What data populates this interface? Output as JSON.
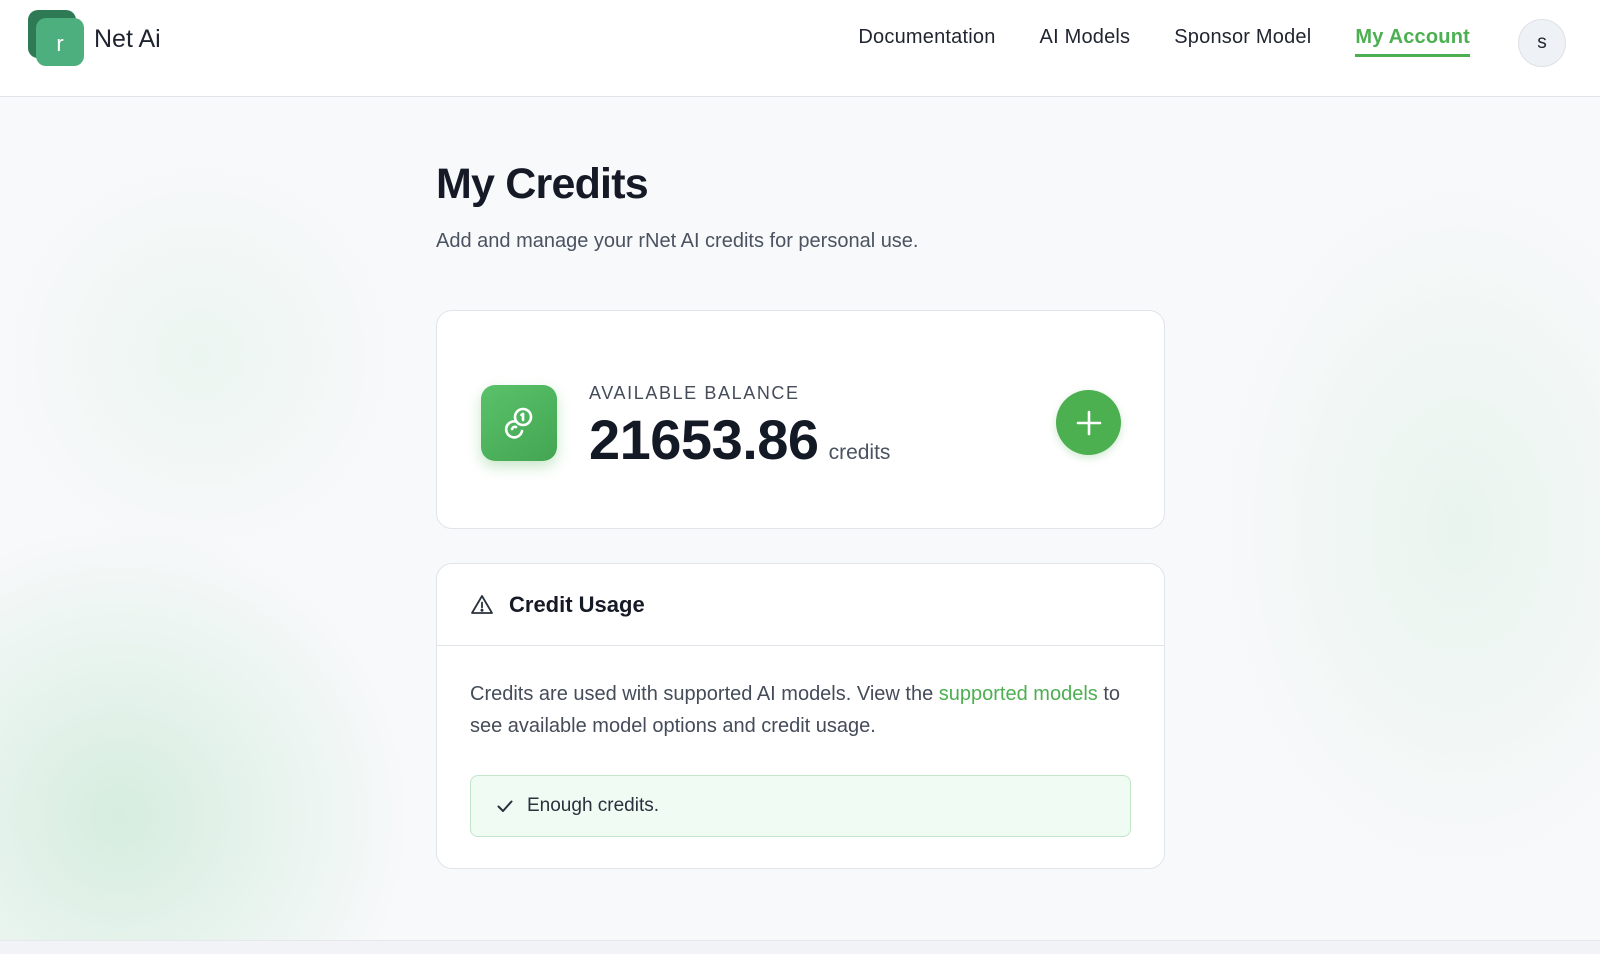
{
  "brand": {
    "logo_letter": "r",
    "name": "Net Ai"
  },
  "nav": {
    "items": [
      {
        "label": "Documentation"
      },
      {
        "label": "AI Models"
      },
      {
        "label": "Sponsor Model"
      },
      {
        "label": "My Account",
        "active": true
      }
    ]
  },
  "user": {
    "avatar_initial": "s"
  },
  "page": {
    "title": "My Credits",
    "subtitle": "Add and manage your rNet AI credits for personal use."
  },
  "balance": {
    "label": "AVAILABLE BALANCE",
    "value": "21653.86",
    "unit": "credits",
    "icon": "coins-icon",
    "add_icon": "plus-icon"
  },
  "usage": {
    "title": "Credit Usage",
    "icon": "warning-triangle-icon",
    "text_before": "Credits are used with supported AI models. View the ",
    "link_text": "supported models",
    "text_after": " to see available model options and credit usage.",
    "status_icon": "check-icon",
    "status_text": "Enough credits."
  },
  "colors": {
    "accent": "#4caf50",
    "logo_dark": "#2e7a55",
    "logo_light": "#4caf7d",
    "status_bg": "#f0fbf3",
    "status_border": "#bfe6c9"
  }
}
